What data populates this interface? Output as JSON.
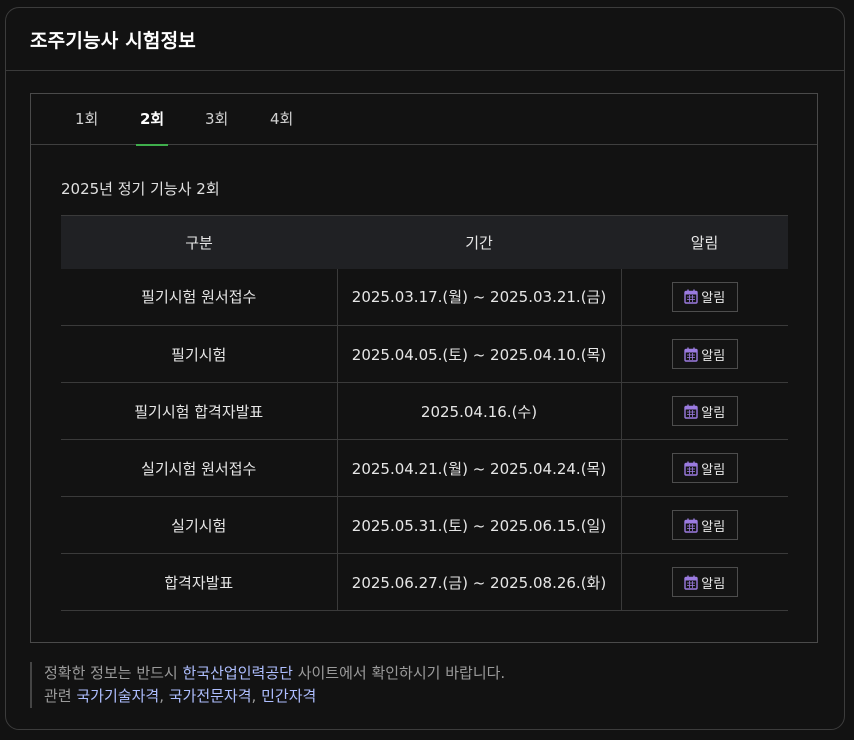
{
  "card": {
    "title": "조주기능사 시험정보"
  },
  "tabs": [
    {
      "label": "1회",
      "active": false
    },
    {
      "label": "2회",
      "active": true
    },
    {
      "label": "3회",
      "active": false
    },
    {
      "label": "4회",
      "active": false
    }
  ],
  "section_title": "2025년 정기 기능사 2회",
  "table": {
    "headers": [
      "구분",
      "기간",
      "알림"
    ],
    "rows": [
      {
        "category": "필기시험 원서접수",
        "period": "2025.03.17.(월) ~ 2025.03.21.(금)",
        "alarm": "알림"
      },
      {
        "category": "필기시험",
        "period": "2025.04.05.(토) ~ 2025.04.10.(목)",
        "alarm": "알림"
      },
      {
        "category": "필기시험 합격자발표",
        "period": "2025.04.16.(수)",
        "alarm": "알림"
      },
      {
        "category": "실기시험 원서접수",
        "period": "2025.04.21.(월) ~ 2025.04.24.(목)",
        "alarm": "알림"
      },
      {
        "category": "실기시험",
        "period": "2025.05.31.(토) ~ 2025.06.15.(일)",
        "alarm": "알림"
      },
      {
        "category": "합격자발표",
        "period": "2025.06.27.(금) ~ 2025.08.26.(화)",
        "alarm": "알림"
      }
    ]
  },
  "notice": {
    "line1_prefix": "정확한 정보는 반드시 ",
    "line1_link": "한국산업인력공단",
    "line1_suffix": " 사이트에서 확인하시기 바랍니다.",
    "line2_prefix": "관련 ",
    "links": [
      "국가기술자격",
      "국가전문자격",
      "민간자격"
    ],
    "separator": ", "
  },
  "icons": {
    "alarm": "calendar-icon"
  },
  "colors": {
    "accent": "#3fae4c",
    "link": "#aebeff",
    "icon": "#9b7be0"
  }
}
